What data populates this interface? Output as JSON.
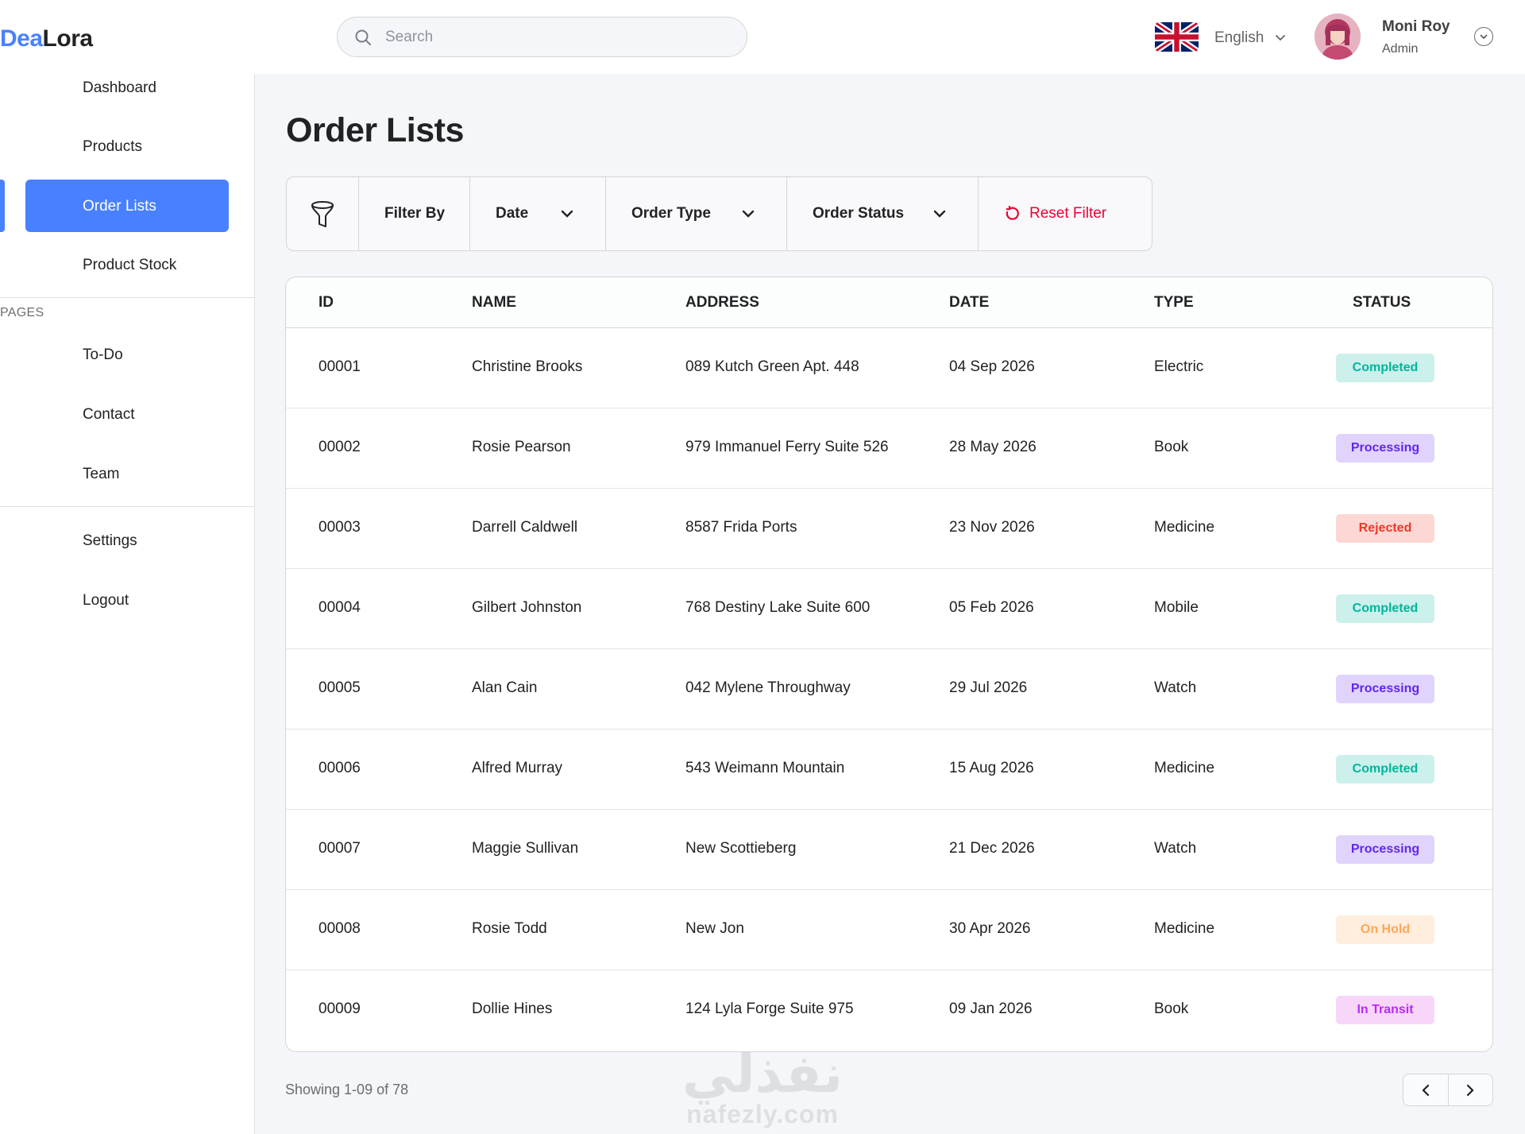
{
  "brand": {
    "part1": "Dea",
    "part2": "Lora"
  },
  "search": {
    "placeholder": "Search"
  },
  "language": {
    "label": "English",
    "flag_icon": "uk-flag-icon"
  },
  "user": {
    "name": "Moni Roy",
    "role": "Admin"
  },
  "sidebar": {
    "items_top": [
      "Dashboard",
      "Products",
      "Order Lists",
      "Product Stock"
    ],
    "active_item": "Order Lists",
    "section_title": "PAGES",
    "items_pages": [
      "To-Do",
      "Contact",
      "Team"
    ],
    "items_bottom": [
      "Settings",
      "Logout"
    ]
  },
  "page": {
    "title": "Order Lists"
  },
  "filters": {
    "icon": "funnel-icon",
    "filter_by": "Filter By",
    "date": "Date",
    "order_type": "Order Type",
    "order_status": "Order Status",
    "reset": "Reset Filter"
  },
  "table": {
    "headers": [
      "ID",
      "NAME",
      "ADDRESS",
      "DATE",
      "TYPE",
      "STATUS"
    ],
    "rows": [
      {
        "id": "00001",
        "name": "Christine Brooks",
        "address": "089 Kutch Green Apt. 448",
        "date": "04 Sep 2026",
        "type": "Electric",
        "status": "Completed"
      },
      {
        "id": "00002",
        "name": "Rosie Pearson",
        "address": "979 Immanuel Ferry Suite 526",
        "date": "28 May 2026",
        "type": "Book",
        "status": "Processing"
      },
      {
        "id": "00003",
        "name": "Darrell Caldwell",
        "address": "8587 Frida Ports",
        "date": "23 Nov 2026",
        "type": "Medicine",
        "status": "Rejected"
      },
      {
        "id": "00004",
        "name": "Gilbert Johnston",
        "address": "768 Destiny Lake Suite 600",
        "date": "05 Feb 2026",
        "type": "Mobile",
        "status": "Completed"
      },
      {
        "id": "00005",
        "name": "Alan Cain",
        "address": "042 Mylene Throughway",
        "date": "29 Jul 2026",
        "type": "Watch",
        "status": "Processing"
      },
      {
        "id": "00006",
        "name": "Alfred Murray",
        "address": "543 Weimann Mountain",
        "date": "15 Aug 2026",
        "type": "Medicine",
        "status": "Completed"
      },
      {
        "id": "00007",
        "name": "Maggie Sullivan",
        "address": "New Scottieberg",
        "date": "21 Dec 2026",
        "type": "Watch",
        "status": "Processing"
      },
      {
        "id": "00008",
        "name": "Rosie Todd",
        "address": "New Jon",
        "date": "30 Apr 2026",
        "type": "Medicine",
        "status": "On Hold"
      },
      {
        "id": "00009",
        "name": "Dollie Hines",
        "address": "124 Lyla Forge Suite 975",
        "date": "09 Jan 2026",
        "type": "Book",
        "status": "In Transit"
      }
    ]
  },
  "pagination": {
    "showing": "Showing 1-09 of 78"
  },
  "watermark": {
    "arabic": "نفذلي",
    "latin": "nafezly.com"
  },
  "colors": {
    "primary": "#4880ff",
    "reset": "#ea0234",
    "completed": "#00b69b",
    "processing": "#6226ef",
    "rejected": "#ef3826",
    "on_hold": "#ffa756",
    "in_transit": "#ba29ff"
  }
}
